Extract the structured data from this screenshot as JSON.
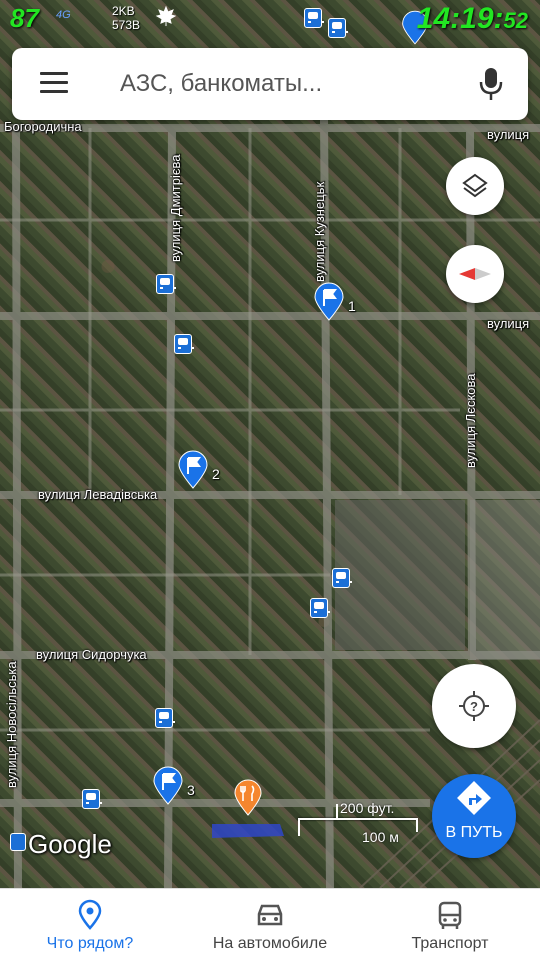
{
  "status_bar": {
    "battery": "87",
    "signal": "4G",
    "net_up": "2KB",
    "net_down": "573B",
    "time": "14:19:",
    "seconds": "52"
  },
  "search": {
    "placeholder": "АЗС, банкоматы..."
  },
  "map": {
    "streets": [
      "Богородична",
      "вулиця Дмитрієва",
      "вулиця Кузнецьк",
      "вулиця",
      "вулиця",
      "вулиця Лєскова",
      "вулиця Левадівська",
      "вулиця Сидорчука",
      "вулиця Новосільська"
    ],
    "pins": [
      "1",
      "2",
      "3"
    ],
    "attribution": "Google",
    "scale_ft": "200 фут.",
    "scale_m": "100 м",
    "colors": {
      "pin": "#1a73e8",
      "food_pin": "#f5862e",
      "accent": "#1a73e8"
    }
  },
  "controls": {
    "go_label": "В ПУТЬ"
  },
  "bottom_nav": {
    "items": [
      {
        "label": "Что рядом?",
        "icon": "location-pin-icon",
        "active": true
      },
      {
        "label": "На автомобиле",
        "icon": "car-icon",
        "active": false
      },
      {
        "label": "Транспорт",
        "icon": "bus-icon",
        "active": false
      }
    ]
  }
}
